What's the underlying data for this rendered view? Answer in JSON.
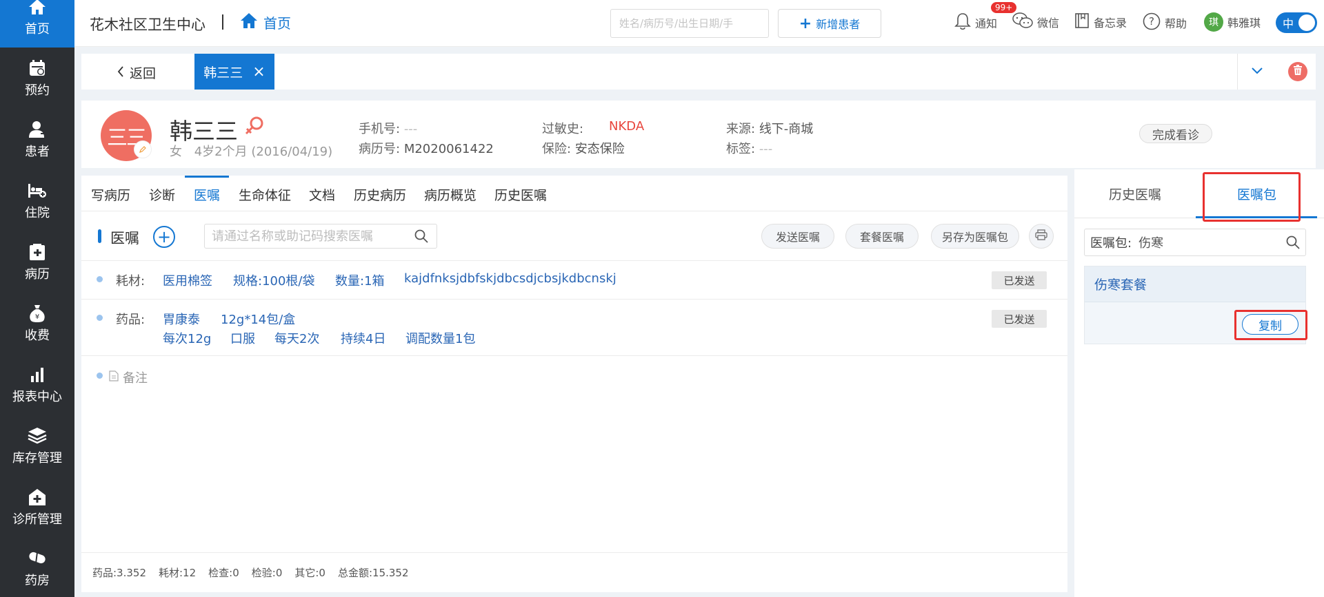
{
  "sidebar": {
    "items": [
      {
        "label": "首页",
        "icon": "home-icon",
        "active": true
      },
      {
        "label": "预约",
        "icon": "calendar-icon"
      },
      {
        "label": "患者",
        "icon": "patient-icon"
      },
      {
        "label": "住院",
        "icon": "bed-icon"
      },
      {
        "label": "病历",
        "icon": "record-icon"
      },
      {
        "label": "收费",
        "icon": "money-bag-icon"
      },
      {
        "label": "报表中心",
        "icon": "bar-chart-icon"
      },
      {
        "label": "库存管理",
        "icon": "layers-icon"
      },
      {
        "label": "诊所管理",
        "icon": "clinic-icon"
      },
      {
        "label": "药房",
        "icon": "pill-icon"
      }
    ]
  },
  "topbar": {
    "clinic_name": "花木社区卫生中心",
    "home_label": "首页",
    "search_placeholder": "姓名/病历号/出生日期/手",
    "new_patient": "新增患者",
    "notify_label": "通知",
    "notify_badge": "99+",
    "wechat_label": "微信",
    "memo_label": "备忘录",
    "help_label": "帮助",
    "user_avatar": "琪",
    "user_name": "韩雅琪",
    "lang_toggle": "中"
  },
  "tabbar": {
    "back_label": "返回",
    "active_tab": "韩三三",
    "close_glyph": "×"
  },
  "patient": {
    "avatar_text": "三三",
    "name": "韩三三",
    "sex": "女",
    "age_dob": "4岁2个月  (2016/04/19)",
    "phone_label": "手机号:",
    "phone": "---",
    "record_label": "病历号:",
    "record_no": "M2020061422",
    "allergy_label": "过敏史:",
    "allergy": "NKDA",
    "insurance_label": "保险:",
    "insurance": "安态保险",
    "source_label": "来源:",
    "source": "线下-商城",
    "tag_label": "标签:",
    "tag": "---",
    "finish_button": "完成看诊"
  },
  "subtabs": [
    "写病历",
    "诊断",
    "医嘱",
    "生命体征",
    "文档",
    "历史病历",
    "病历概览",
    "历史医嘱"
  ],
  "orders": {
    "title": "医嘱",
    "search_placeholder": "请通过名称或助记码搜索医嘱",
    "send_button": "发送医嘱",
    "combo_button": "套餐医嘱",
    "save_as_button": "另存为医嘱包",
    "rows": [
      {
        "type": "耗材:",
        "name": "医用棉签",
        "spec": "规格:100根/袋",
        "qty": "数量:1箱",
        "note": "kajdfnksjdbfskjdbcsdjcbsjkdbcnskj",
        "status": "已发送"
      },
      {
        "type": "药品:",
        "name": "胃康泰",
        "spec": "12g*14包/盒",
        "dose": "每次12g",
        "route": "口服",
        "freq": "每天2次",
        "duration": "持续4日",
        "dispense": "调配数量1包",
        "status": "已发送"
      }
    ],
    "remark_label": "备注"
  },
  "totals": {
    "drug": "药品:3.352",
    "material": "耗材:12",
    "exam": "检查:0",
    "test": "检验:0",
    "other": "其它:0",
    "total": "总金额:15.352"
  },
  "right_panel": {
    "tab_history": "历史医嘱",
    "tab_package": "医嘱包",
    "search_label": "医嘱包:",
    "search_value": "伤寒",
    "package_name": "伤寒套餐",
    "copy_button": "复制"
  },
  "colors": {
    "sidebar_bg": "#2c2f33",
    "accent": "#1477d2",
    "allergy": "#e8453c",
    "highlight_box": "#e8312f"
  }
}
